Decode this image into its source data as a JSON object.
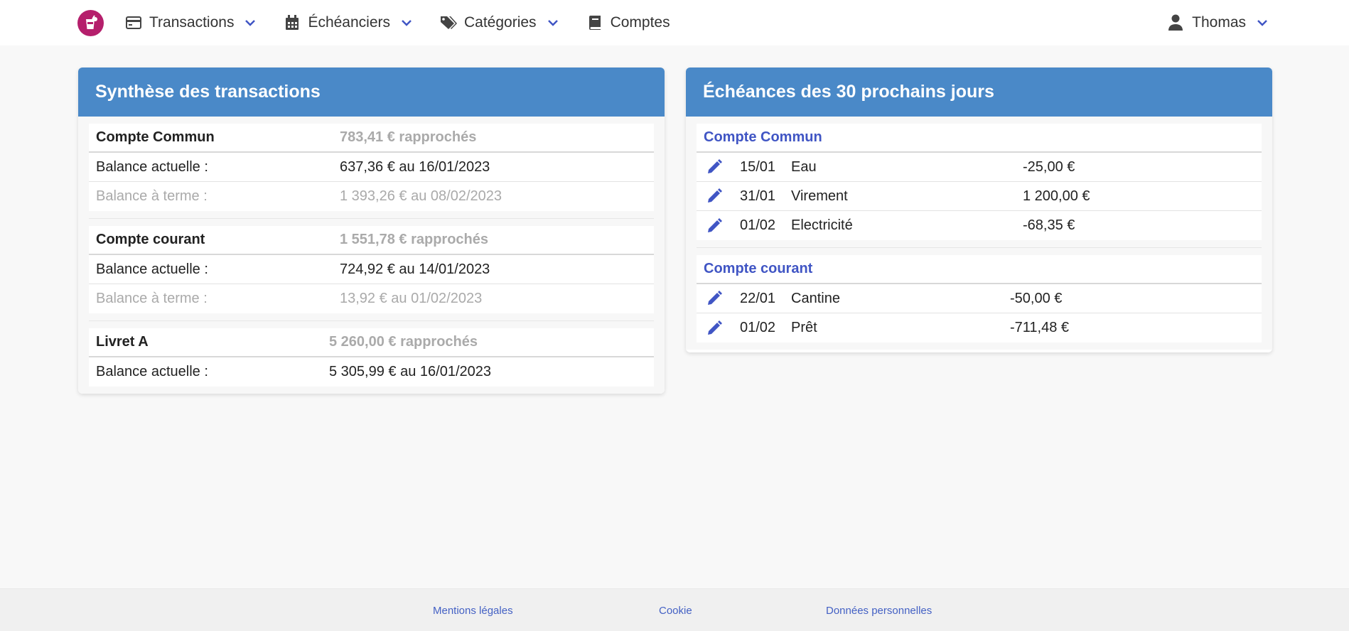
{
  "nav": {
    "items": [
      {
        "label": "Transactions",
        "icon": "credit-card-icon",
        "dropdown": true
      },
      {
        "label": "Échéanciers",
        "icon": "calendar-icon",
        "dropdown": true
      },
      {
        "label": "Catégories",
        "icon": "tags-icon",
        "dropdown": true
      },
      {
        "label": "Comptes",
        "icon": "book-icon",
        "dropdown": false
      }
    ],
    "user": "Thomas"
  },
  "summary": {
    "title": "Synthèse des transactions",
    "accounts": [
      {
        "name": "Compte Commun",
        "reconciled": "783,41 € rapprochés",
        "current_label": "Balance actuelle :",
        "current_value": "637,36 € au 16/01/2023",
        "term_label": "Balance à terme :",
        "term_value": "1 393,26 € au 08/02/2023"
      },
      {
        "name": "Compte courant",
        "reconciled": "1 551,78 € rapprochés",
        "current_label": "Balance actuelle :",
        "current_value": "724,92 € au 14/01/2023",
        "term_label": "Balance à terme :",
        "term_value": "13,92 € au 01/02/2023"
      },
      {
        "name": "Livret A",
        "reconciled": "5 260,00 € rapprochés",
        "current_label": "Balance actuelle :",
        "current_value": "5 305,99 € au 16/01/2023"
      }
    ]
  },
  "schedule": {
    "title": "Échéances des 30 prochains jours",
    "groups": [
      {
        "account": "Compte Commun",
        "items": [
          {
            "date": "15/01",
            "label": "Eau",
            "amount": "-25,00 €"
          },
          {
            "date": "31/01",
            "label": "Virement",
            "amount": "1 200,00 €"
          },
          {
            "date": "01/02",
            "label": "Electricité",
            "amount": "-68,35 €"
          }
        ]
      },
      {
        "account": "Compte courant",
        "items": [
          {
            "date": "22/01",
            "label": "Cantine",
            "amount": "-50,00 €"
          },
          {
            "date": "01/02",
            "label": "Prêt",
            "amount": "-711,48 €"
          }
        ]
      }
    ]
  },
  "footer": {
    "legal": "Mentions légales",
    "cookie": "Cookie",
    "privacy": "Données personnelles"
  },
  "colors": {
    "header_blue": "#4a89c8",
    "accent": "#4055c4",
    "logo": "#b51f6c"
  }
}
